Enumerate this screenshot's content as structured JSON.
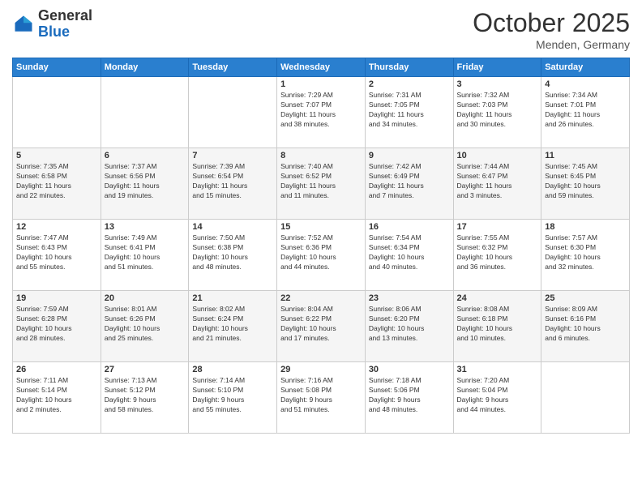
{
  "header": {
    "logo_general": "General",
    "logo_blue": "Blue",
    "month_title": "October 2025",
    "location": "Menden, Germany"
  },
  "days_of_week": [
    "Sunday",
    "Monday",
    "Tuesday",
    "Wednesday",
    "Thursday",
    "Friday",
    "Saturday"
  ],
  "weeks": [
    [
      {
        "day": "",
        "info": ""
      },
      {
        "day": "",
        "info": ""
      },
      {
        "day": "",
        "info": ""
      },
      {
        "day": "1",
        "info": "Sunrise: 7:29 AM\nSunset: 7:07 PM\nDaylight: 11 hours\nand 38 minutes."
      },
      {
        "day": "2",
        "info": "Sunrise: 7:31 AM\nSunset: 7:05 PM\nDaylight: 11 hours\nand 34 minutes."
      },
      {
        "day": "3",
        "info": "Sunrise: 7:32 AM\nSunset: 7:03 PM\nDaylight: 11 hours\nand 30 minutes."
      },
      {
        "day": "4",
        "info": "Sunrise: 7:34 AM\nSunset: 7:01 PM\nDaylight: 11 hours\nand 26 minutes."
      }
    ],
    [
      {
        "day": "5",
        "info": "Sunrise: 7:35 AM\nSunset: 6:58 PM\nDaylight: 11 hours\nand 22 minutes."
      },
      {
        "day": "6",
        "info": "Sunrise: 7:37 AM\nSunset: 6:56 PM\nDaylight: 11 hours\nand 19 minutes."
      },
      {
        "day": "7",
        "info": "Sunrise: 7:39 AM\nSunset: 6:54 PM\nDaylight: 11 hours\nand 15 minutes."
      },
      {
        "day": "8",
        "info": "Sunrise: 7:40 AM\nSunset: 6:52 PM\nDaylight: 11 hours\nand 11 minutes."
      },
      {
        "day": "9",
        "info": "Sunrise: 7:42 AM\nSunset: 6:49 PM\nDaylight: 11 hours\nand 7 minutes."
      },
      {
        "day": "10",
        "info": "Sunrise: 7:44 AM\nSunset: 6:47 PM\nDaylight: 11 hours\nand 3 minutes."
      },
      {
        "day": "11",
        "info": "Sunrise: 7:45 AM\nSunset: 6:45 PM\nDaylight: 10 hours\nand 59 minutes."
      }
    ],
    [
      {
        "day": "12",
        "info": "Sunrise: 7:47 AM\nSunset: 6:43 PM\nDaylight: 10 hours\nand 55 minutes."
      },
      {
        "day": "13",
        "info": "Sunrise: 7:49 AM\nSunset: 6:41 PM\nDaylight: 10 hours\nand 51 minutes."
      },
      {
        "day": "14",
        "info": "Sunrise: 7:50 AM\nSunset: 6:38 PM\nDaylight: 10 hours\nand 48 minutes."
      },
      {
        "day": "15",
        "info": "Sunrise: 7:52 AM\nSunset: 6:36 PM\nDaylight: 10 hours\nand 44 minutes."
      },
      {
        "day": "16",
        "info": "Sunrise: 7:54 AM\nSunset: 6:34 PM\nDaylight: 10 hours\nand 40 minutes."
      },
      {
        "day": "17",
        "info": "Sunrise: 7:55 AM\nSunset: 6:32 PM\nDaylight: 10 hours\nand 36 minutes."
      },
      {
        "day": "18",
        "info": "Sunrise: 7:57 AM\nSunset: 6:30 PM\nDaylight: 10 hours\nand 32 minutes."
      }
    ],
    [
      {
        "day": "19",
        "info": "Sunrise: 7:59 AM\nSunset: 6:28 PM\nDaylight: 10 hours\nand 28 minutes."
      },
      {
        "day": "20",
        "info": "Sunrise: 8:01 AM\nSunset: 6:26 PM\nDaylight: 10 hours\nand 25 minutes."
      },
      {
        "day": "21",
        "info": "Sunrise: 8:02 AM\nSunset: 6:24 PM\nDaylight: 10 hours\nand 21 minutes."
      },
      {
        "day": "22",
        "info": "Sunrise: 8:04 AM\nSunset: 6:22 PM\nDaylight: 10 hours\nand 17 minutes."
      },
      {
        "day": "23",
        "info": "Sunrise: 8:06 AM\nSunset: 6:20 PM\nDaylight: 10 hours\nand 13 minutes."
      },
      {
        "day": "24",
        "info": "Sunrise: 8:08 AM\nSunset: 6:18 PM\nDaylight: 10 hours\nand 10 minutes."
      },
      {
        "day": "25",
        "info": "Sunrise: 8:09 AM\nSunset: 6:16 PM\nDaylight: 10 hours\nand 6 minutes."
      }
    ],
    [
      {
        "day": "26",
        "info": "Sunrise: 7:11 AM\nSunset: 5:14 PM\nDaylight: 10 hours\nand 2 minutes."
      },
      {
        "day": "27",
        "info": "Sunrise: 7:13 AM\nSunset: 5:12 PM\nDaylight: 9 hours\nand 58 minutes."
      },
      {
        "day": "28",
        "info": "Sunrise: 7:14 AM\nSunset: 5:10 PM\nDaylight: 9 hours\nand 55 minutes."
      },
      {
        "day": "29",
        "info": "Sunrise: 7:16 AM\nSunset: 5:08 PM\nDaylight: 9 hours\nand 51 minutes."
      },
      {
        "day": "30",
        "info": "Sunrise: 7:18 AM\nSunset: 5:06 PM\nDaylight: 9 hours\nand 48 minutes."
      },
      {
        "day": "31",
        "info": "Sunrise: 7:20 AM\nSunset: 5:04 PM\nDaylight: 9 hours\nand 44 minutes."
      },
      {
        "day": "",
        "info": ""
      }
    ]
  ]
}
